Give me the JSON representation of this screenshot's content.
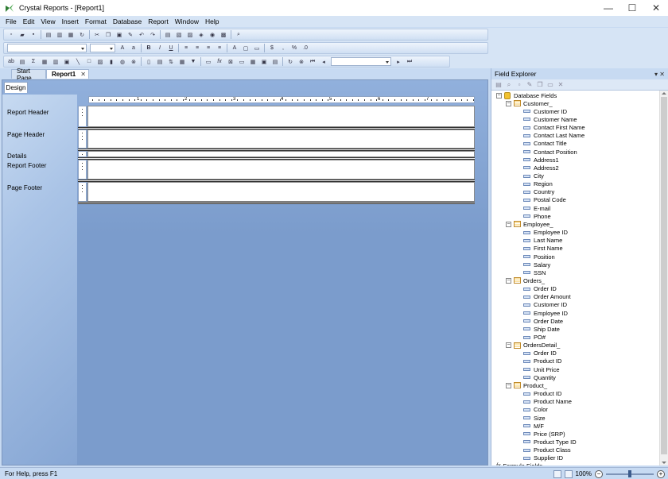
{
  "window": {
    "title": "Crystal Reports - [Report1]",
    "controls": [
      "—",
      "☐",
      "✕"
    ]
  },
  "menu": [
    "File",
    "Edit",
    "View",
    "Insert",
    "Format",
    "Database",
    "Report",
    "Window",
    "Help"
  ],
  "tabs": [
    {
      "label": "Start Page"
    },
    {
      "label": "Report1",
      "close": "✕"
    }
  ],
  "design": {
    "tab_label": "Design",
    "sections": [
      "Report Header",
      "Page Header",
      "Details",
      "Report Footer",
      "Page Footer"
    ],
    "ruler_numbers": [
      "1",
      "2",
      "3",
      "4",
      "5",
      "6",
      "7"
    ]
  },
  "field_explorer": {
    "title": "Field Explorer",
    "pin": "▾ ✕",
    "tree": [
      {
        "kind": "db",
        "label": "Database Fields",
        "level": 0
      },
      {
        "kind": "table",
        "label": "Customer_",
        "level": 1
      },
      {
        "kind": "field",
        "label": "Customer ID",
        "level": 2
      },
      {
        "kind": "field",
        "label": "Customer Name",
        "level": 2
      },
      {
        "kind": "field",
        "label": "Contact First Name",
        "level": 2
      },
      {
        "kind": "field",
        "label": "Contact Last Name",
        "level": 2
      },
      {
        "kind": "field",
        "label": "Contact Title",
        "level": 2
      },
      {
        "kind": "field",
        "label": "Contact Position",
        "level": 2
      },
      {
        "kind": "field",
        "label": "Address1",
        "level": 2
      },
      {
        "kind": "field",
        "label": "Address2",
        "level": 2
      },
      {
        "kind": "field",
        "label": "City",
        "level": 2
      },
      {
        "kind": "field",
        "label": "Region",
        "level": 2
      },
      {
        "kind": "field",
        "label": "Country",
        "level": 2
      },
      {
        "kind": "field",
        "label": "Postal Code",
        "level": 2
      },
      {
        "kind": "field",
        "label": "E-mail",
        "level": 2
      },
      {
        "kind": "field",
        "label": "Phone",
        "level": 2
      },
      {
        "kind": "table",
        "label": "Employee_",
        "level": 1
      },
      {
        "kind": "field",
        "label": "Employee ID",
        "level": 2
      },
      {
        "kind": "field",
        "label": "Last Name",
        "level": 2
      },
      {
        "kind": "field",
        "label": "First Name",
        "level": 2
      },
      {
        "kind": "field",
        "label": "Position",
        "level": 2
      },
      {
        "kind": "field",
        "label": "Salary",
        "level": 2
      },
      {
        "kind": "field",
        "label": "SSN",
        "level": 2
      },
      {
        "kind": "table",
        "label": "Orders_",
        "level": 1
      },
      {
        "kind": "field",
        "label": "Order ID",
        "level": 2
      },
      {
        "kind": "field",
        "label": "Order Amount",
        "level": 2
      },
      {
        "kind": "field",
        "label": "Customer ID",
        "level": 2
      },
      {
        "kind": "field",
        "label": "Employee ID",
        "level": 2
      },
      {
        "kind": "field",
        "label": "Order Date",
        "level": 2
      },
      {
        "kind": "field",
        "label": "Ship Date",
        "level": 2
      },
      {
        "kind": "field",
        "label": "PO#",
        "level": 2
      },
      {
        "kind": "table",
        "label": "OrdersDetail_",
        "level": 1
      },
      {
        "kind": "field",
        "label": "Order ID",
        "level": 2
      },
      {
        "kind": "field",
        "label": "Product ID",
        "level": 2
      },
      {
        "kind": "field",
        "label": "Unit Price",
        "level": 2
      },
      {
        "kind": "field",
        "label": "Quantity",
        "level": 2
      },
      {
        "kind": "table",
        "label": "Product_",
        "level": 1
      },
      {
        "kind": "field",
        "label": "Product ID",
        "level": 2
      },
      {
        "kind": "field",
        "label": "Product Name",
        "level": 2
      },
      {
        "kind": "field",
        "label": "Color",
        "level": 2
      },
      {
        "kind": "field",
        "label": "Size",
        "level": 2
      },
      {
        "kind": "field",
        "label": "M/F",
        "level": 2
      },
      {
        "kind": "field",
        "label": "Price (SRP)",
        "level": 2
      },
      {
        "kind": "field",
        "label": "Product Type ID",
        "level": 2
      },
      {
        "kind": "field",
        "label": "Product Class",
        "level": 2
      },
      {
        "kind": "field",
        "label": "Supplier ID",
        "level": 2
      },
      {
        "kind": "formula",
        "label": "Formula Fields",
        "level": 0
      }
    ]
  },
  "status": {
    "help": "For Help, press F1",
    "zoom": "100%"
  },
  "colors": {
    "accent": "#c7daf2",
    "design_bg": "#7b9ccc"
  }
}
